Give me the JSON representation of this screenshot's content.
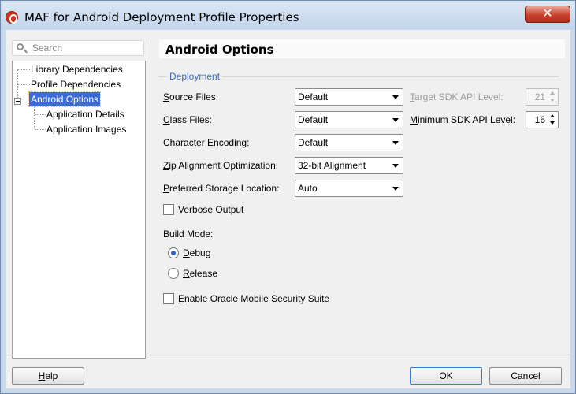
{
  "window": {
    "title": "MAF for Android Deployment Profile Properties",
    "close_glyph": "✕"
  },
  "search": {
    "placeholder": "Search"
  },
  "tree": {
    "items": [
      {
        "label": "Library Dependencies"
      },
      {
        "label": "Profile Dependencies"
      },
      {
        "label": "Android Options",
        "selected": true
      },
      {
        "label": "Application Details"
      },
      {
        "label": "Application Images"
      }
    ]
  },
  "panel": {
    "title": "Android Options",
    "group_title": "Deployment",
    "fields": {
      "source_files": {
        "label": "Source Files:",
        "value": "Default"
      },
      "class_files": {
        "label": "Class Files:",
        "value": "Default"
      },
      "character_encoding": {
        "label": "Character Encoding:",
        "value": "Default"
      },
      "zip_alignment": {
        "label": "Zip Alignment Optimization:",
        "value": "32-bit Alignment"
      },
      "storage_location": {
        "label": "Preferred Storage Location:",
        "value": "Auto"
      },
      "target_sdk": {
        "label": "Target SDK API Level:",
        "value": "21"
      },
      "minimum_sdk": {
        "label": "Minimum SDK API Level:",
        "value": "16"
      }
    },
    "verbose_output": {
      "label": "Verbose Output",
      "checked": false
    },
    "build_mode": {
      "label": "Build Mode:",
      "debug": {
        "label": "Debug",
        "checked": true
      },
      "release": {
        "label": "Release",
        "checked": false
      }
    },
    "security_suite": {
      "label": "Enable Oracle Mobile Security Suite",
      "checked": false
    }
  },
  "buttons": {
    "help": "Help",
    "ok": "OK",
    "cancel": "Cancel"
  }
}
